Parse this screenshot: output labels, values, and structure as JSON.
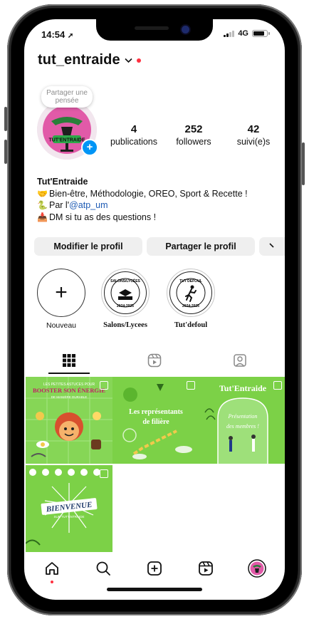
{
  "status_bar": {
    "time": "14:54",
    "network": "4G"
  },
  "profile": {
    "username": "tut_entraide",
    "note_text": "Partager une pensée",
    "stats": [
      {
        "value": "4",
        "label": "publications"
      },
      {
        "value": "252",
        "label": "followers"
      },
      {
        "value": "42",
        "label": "suivi(e)s"
      }
    ],
    "bio": {
      "name": "Tut'Entraide",
      "line1": "Bien-être, Méthodologie, OREO, Sport & Recette !",
      "line2_prefix": "Par l'",
      "line2_mention": "@atp_um",
      "line3": "DM si tu as des questions !"
    },
    "avatar_text": "TUT'ENTRAIDE"
  },
  "buttons": {
    "edit_profile": "Modifier le profil",
    "share_profile": "Partager le profil"
  },
  "highlights": [
    {
      "label": "Nouveau"
    },
    {
      "label": "Salons/Lycees",
      "badge_top": "SALONS/LYCÉES",
      "badge_bottom": "2024-2025"
    },
    {
      "label": "Tut'defoul",
      "badge_top": "TUT'DEFOUL",
      "badge_bottom": "2024-2025"
    }
  ],
  "posts": [
    {
      "title": "BOOSTER SON ÉNERGIE",
      "subtitle": "LES PETITES ASTUCES POUR",
      "tagline": "DE MANIÈRE DURABLE"
    },
    {
      "title": "Les représentants de filière"
    },
    {
      "title": "Tut'Entraide",
      "subtitle": "Présentation des membres !"
    },
    {
      "title": "BIENVENUE",
      "subtitle": "SUR TUT'ENTRAIDE"
    }
  ],
  "icons": {
    "grid_tab": "grid-icon",
    "reels_tab": "reels-icon",
    "tagged_tab": "tagged-icon",
    "nav": [
      "home-icon",
      "search-icon",
      "create-icon",
      "reels-icon",
      "profile-avatar"
    ]
  },
  "colors": {
    "accent_blue": "#0095f6",
    "notification_red": "#ff3040",
    "post_green": "#7bd148"
  }
}
